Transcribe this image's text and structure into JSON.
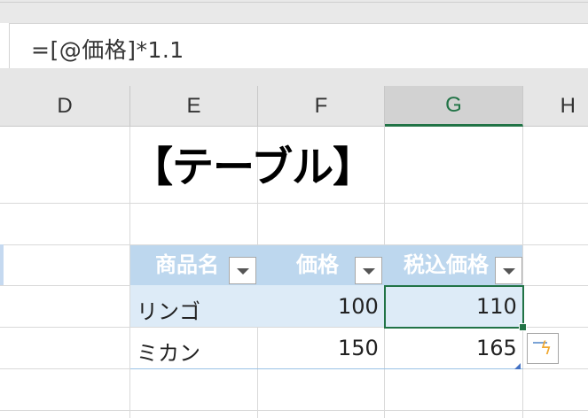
{
  "formula_bar": {
    "text": "=[@価格]*1.1"
  },
  "column_headers": [
    "D",
    "E",
    "F",
    "G",
    "H"
  ],
  "selected_column": "G",
  "title": "【テーブル】",
  "table": {
    "headers": [
      "商品名",
      "価格",
      "税込価格"
    ],
    "rows": [
      [
        "リンゴ",
        "100",
        "110"
      ],
      [
        "ミカン",
        "150",
        "165"
      ]
    ]
  },
  "colors": {
    "header_fill": "#bdd7ee",
    "banded_row_fill": "#ddebf7",
    "selection_border": "#217346"
  }
}
